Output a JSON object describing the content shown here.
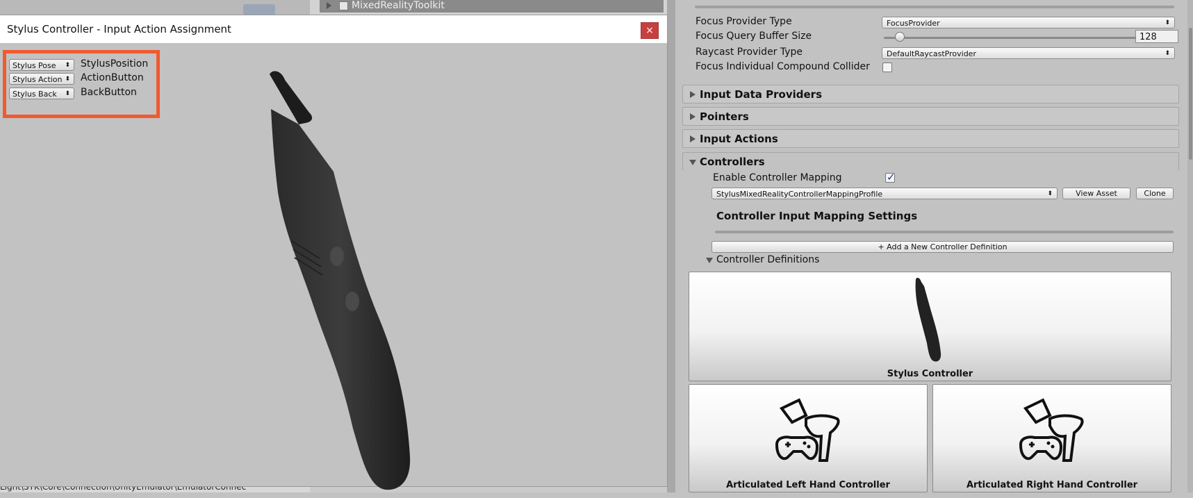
{
  "hierarchy": {
    "item_label": "MixedRealityToolkit"
  },
  "bottom_path": "Light\\STK\\Core\\Connection\\UnityEmulator\\EmulatorConnec",
  "popup": {
    "title": "Stylus Controller - Input Action Assignment",
    "close_icon": "×",
    "assignments": [
      {
        "select": "Stylus Pose",
        "action": "StylusPosition"
      },
      {
        "select": "Stylus Action",
        "action": "ActionButton"
      },
      {
        "select": "Stylus Back",
        "action": "BackButton"
      }
    ]
  },
  "inspector": {
    "focus_provider_type_label": "Focus Provider Type",
    "focus_provider_type_value": "FocusProvider",
    "focus_query_buffer_label": "Focus Query Buffer Size",
    "focus_query_buffer_value": "128",
    "raycast_provider_label": "Raycast Provider Type",
    "raycast_provider_value": "DefaultRaycastProvider",
    "focus_compound_label": "Focus Individual Compound Collider",
    "sections": {
      "input_data_providers": "Input Data Providers",
      "pointers": "Pointers",
      "input_actions": "Input Actions",
      "controllers": "Controllers"
    },
    "enable_mapping_label": "Enable Controller Mapping",
    "mapping_profile_value": "StylusMixedRealityControllerMappingProfile",
    "view_asset_label": "View Asset",
    "clone_label": "Clone",
    "mapping_settings_title": "Controller Input Mapping Settings",
    "add_definition_label": "+ Add a New Controller Definition",
    "definitions_label": "Controller Definitions",
    "controllers": [
      "Stylus Controller",
      "Articulated Left Hand Controller",
      "Articulated Right Hand Controller"
    ]
  }
}
